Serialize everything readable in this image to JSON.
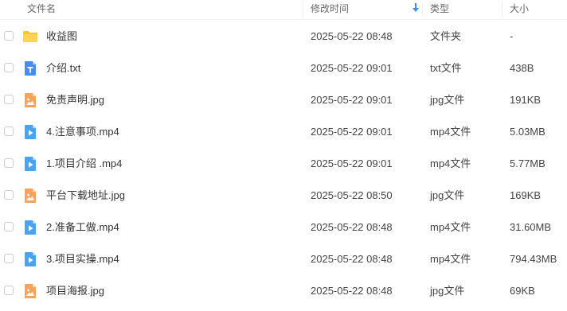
{
  "header": {
    "col_name": "文件名",
    "col_time": "修改时间",
    "col_type": "类型",
    "col_size": "大小",
    "sort_icon": "arrow-down-icon"
  },
  "colors": {
    "folder": "#FFC629",
    "txt": "#4A8CF6",
    "jpg": "#F9A35B",
    "mp4": "#4BA3F8"
  },
  "files": [
    {
      "name": "收益图",
      "time": "2025-05-22 08:48",
      "type": "文件夹",
      "size": "-",
      "icon": "folder-icon"
    },
    {
      "name": "介绍.txt",
      "time": "2025-05-22 09:01",
      "type": "txt文件",
      "size": "438B",
      "icon": "txt-file-icon"
    },
    {
      "name": "免责声明.jpg",
      "time": "2025-05-22 09:01",
      "type": "jpg文件",
      "size": "191KB",
      "icon": "image-file-icon"
    },
    {
      "name": "4.注意事项.mp4",
      "time": "2025-05-22 09:01",
      "type": "mp4文件",
      "size": "5.03MB",
      "icon": "video-file-icon"
    },
    {
      "name": "1.项目介绍 .mp4",
      "time": "2025-05-22 09:01",
      "type": "mp4文件",
      "size": "5.77MB",
      "icon": "video-file-icon"
    },
    {
      "name": "平台下载地址.jpg",
      "time": "2025-05-22 08:50",
      "type": "jpg文件",
      "size": "169KB",
      "icon": "image-file-icon"
    },
    {
      "name": "2.准备工做.mp4",
      "time": "2025-05-22 08:48",
      "type": "mp4文件",
      "size": "31.60MB",
      "icon": "video-file-icon"
    },
    {
      "name": "3.项目实操.mp4",
      "time": "2025-05-22 08:48",
      "type": "mp4文件",
      "size": "794.43MB",
      "icon": "video-file-icon"
    },
    {
      "name": "项目海报.jpg",
      "time": "2025-05-22 08:48",
      "type": "jpg文件",
      "size": "69KB",
      "icon": "image-file-icon"
    }
  ]
}
